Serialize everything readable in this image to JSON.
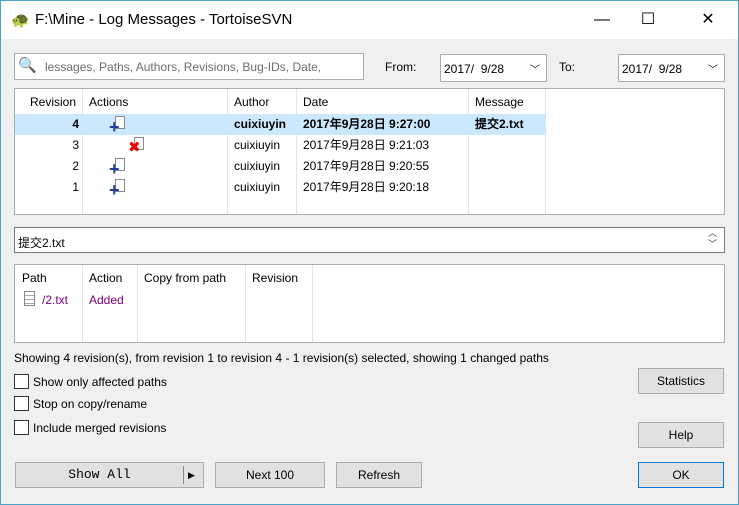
{
  "window": {
    "title": "F:\\Mine - Log Messages - TortoiseSVN",
    "minimize": "—",
    "maximize": "☐",
    "close": "✕"
  },
  "filter": {
    "placeholder": "Messages, Paths, Authors, Revisions, Bug-IDs, Date,",
    "display": "lessages, Paths, Authors, Revisions, Bug-IDs, Date,"
  },
  "from": {
    "label": "From:",
    "value": "2017/  9/28"
  },
  "to": {
    "label": "To:",
    "value": "2017/  9/28"
  },
  "log": {
    "columns": [
      "Revision",
      "Actions",
      "Author",
      "Date",
      "Message"
    ],
    "rows": [
      {
        "revision": "4",
        "action": "added",
        "author": "cuixiuyin",
        "date": "2017年9月28日 9:27:00",
        "message": "提交2.txt",
        "selected": true
      },
      {
        "revision": "3",
        "action": "deleted",
        "author": "cuixiuyin",
        "date": "2017年9月28日 9:21:03",
        "message": ""
      },
      {
        "revision": "2",
        "action": "added",
        "author": "cuixiuyin",
        "date": "2017年9月28日 9:20:55",
        "message": ""
      },
      {
        "revision": "1",
        "action": "added",
        "author": "cuixiuyin",
        "date": "2017年9月28日 9:20:18",
        "message": ""
      }
    ]
  },
  "message_text": "提交2.txt",
  "paths": {
    "columns": [
      "Path",
      "Action",
      "Copy from path",
      "Revision"
    ],
    "rows": [
      {
        "path": "/2.txt",
        "action": "Added",
        "copy_from": "",
        "revision": ""
      }
    ]
  },
  "status": "Showing 4 revision(s), from revision 1 to revision 4 - 1 revision(s) selected, showing 1 changed paths",
  "options": [
    {
      "label": "Show only affected paths",
      "checked": false
    },
    {
      "label": "Stop on copy/rename",
      "checked": false
    },
    {
      "label": "Include merged revisions",
      "checked": false
    }
  ],
  "buttons": {
    "statistics": "Statistics",
    "help": "Help",
    "show_all": "Show All",
    "next": "Next 100",
    "refresh": "Refresh",
    "ok": "OK"
  },
  "colors": {
    "selection": "#cce8ff",
    "added_text": "#800080",
    "border": "#4aa3c8"
  }
}
